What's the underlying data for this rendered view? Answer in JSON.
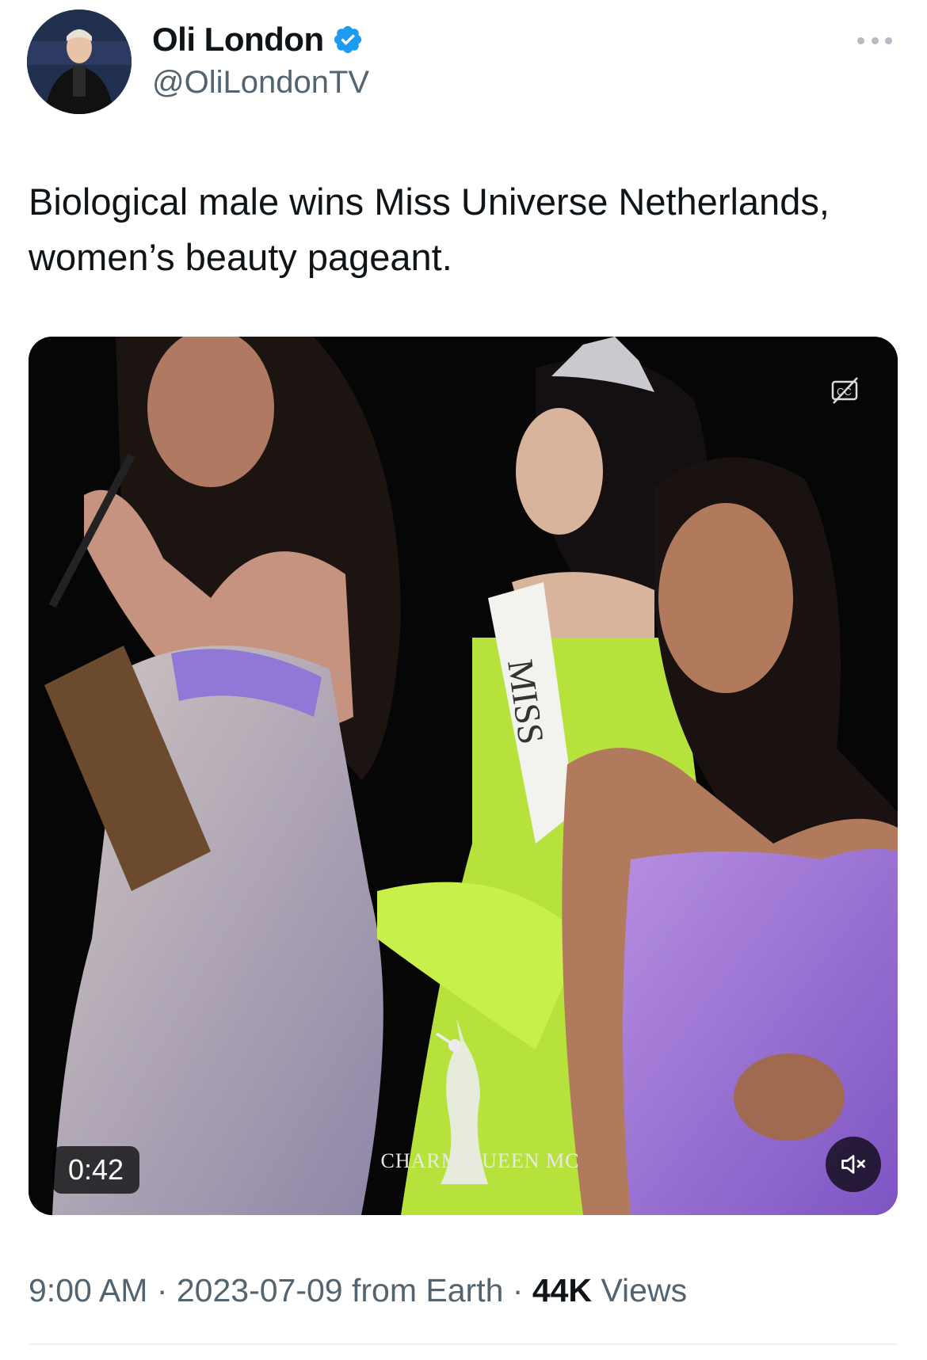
{
  "tweet": {
    "author": {
      "display_name": "Oli London",
      "handle": "@OliLondonTV",
      "verified": true
    },
    "text": "Biological male wins Miss Universe Netherlands, women’s beauty pageant.",
    "media": {
      "duration": "0:42",
      "watermark": "CHARM QUEEN MC",
      "sash_text": "MISS",
      "muted": true
    },
    "meta": {
      "time": "9:00 AM",
      "separator1": " · ",
      "date": "2023-07-09",
      "source": " from Earth",
      "separator2": " · ",
      "views_count": "44K",
      "views_label": " Views"
    }
  },
  "colors": {
    "verified": "#1d9bf0",
    "secondary_text": "#536471",
    "primary_text": "#0f1419"
  }
}
